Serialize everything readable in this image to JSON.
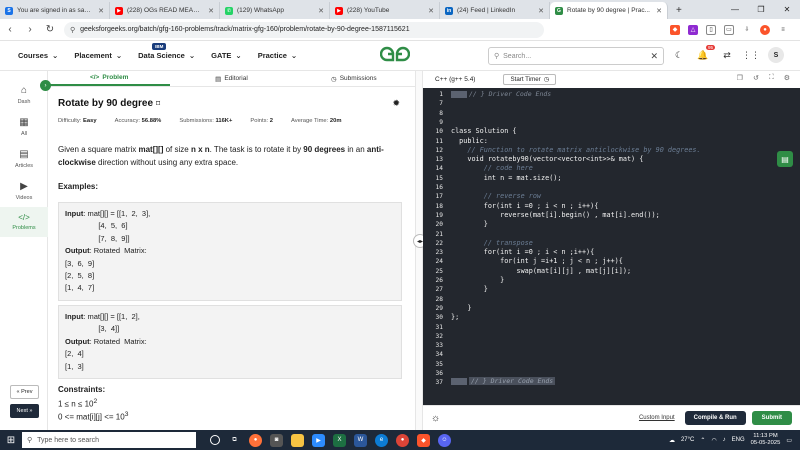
{
  "browser": {
    "tabs": [
      {
        "label": "You are signed in as sambhav...",
        "color": "#1a73e8",
        "glyph": "S"
      },
      {
        "label": "(228) OGs READ MEAN COMM...",
        "color": "#ff0000",
        "glyph": "▶"
      },
      {
        "label": "(129) WhatsApp",
        "color": "#25d366",
        "glyph": "✆"
      },
      {
        "label": "(228) YouTube",
        "color": "#ff0000",
        "glyph": "▶"
      },
      {
        "label": "(24) Feed | LinkedIn",
        "color": "#0a66c2",
        "glyph": "in"
      },
      {
        "label": "Rotate by 90 degree | Prac...",
        "color": "#2f8d46",
        "glyph": "G"
      }
    ],
    "url": "geeksforgeeks.org/batch/gfg-160-problems/track/matrix-gfg-160/problem/rotate-by-90-degree-1587115621"
  },
  "nav": {
    "courses": "Courses",
    "placement": "Placement",
    "data_science": "Data Science",
    "ibm_badge": "IBM",
    "gate": "GATE",
    "practice": "Practice",
    "search_placeholder": "Search...",
    "notif_count": "95",
    "avatar": "S"
  },
  "sidebar": {
    "items": [
      {
        "label": "Dash",
        "icon": "⌂"
      },
      {
        "label": "All",
        "icon": "▦"
      },
      {
        "label": "Articles",
        "icon": "▤"
      },
      {
        "label": "Videos",
        "icon": "▶"
      },
      {
        "label": "Problems",
        "icon": "</>"
      }
    ],
    "prev": "« Prev",
    "next": "Next »"
  },
  "problem": {
    "tabs": [
      "Problem",
      "Editorial",
      "Submissions"
    ],
    "title": "Rotate by 90 degree",
    "difficulty_label": "Difficulty:",
    "difficulty": "Easy",
    "accuracy_label": "Accuracy:",
    "accuracy": "56.88%",
    "submissions_label": "Submissions:",
    "submissions": "116K+",
    "points_label": "Points:",
    "points": "2",
    "avgtime_label": "Average Time:",
    "avgtime": "20m",
    "desc_1": "Given a square matrix ",
    "desc_mat": "mat[][]",
    "desc_2": " of size ",
    "desc_nxn": "n x n",
    "desc_3": ". The task is to rotate it by ",
    "desc_90": "90 degrees",
    "desc_4": " in an ",
    "desc_acw": "anti-clockwise",
    "desc_5": " direction without using any extra space.",
    "examples_heading": "Examples:",
    "ex1": {
      "input_label": "Input",
      "input_lines": [
        ": mat[][] = [[1,  2,  3],",
        "                [4,  5,  6]",
        "                [7,  8,  9]]"
      ],
      "output_label": "Output",
      "output_text": ": Rotated  Matrix:",
      "output_lines": [
        "[3,  6,  9]",
        "[2,  5,  8]",
        "[1,  4,  7]"
      ]
    },
    "ex2": {
      "input_label": "Input",
      "input_lines": [
        ": mat[][] = [[1,  2],",
        "                [3,  4]]"
      ],
      "output_label": "Output",
      "output_text": ": Rotated  Matrix:",
      "output_lines": [
        "[2,  4]",
        "[1,  3]"
      ]
    },
    "constraints_heading": "Constraints:",
    "constraint_1": "1 ≤ n ≤ 10",
    "constraint_1_sup": "2",
    "constraint_2": "0 <= mat[i][j] <= 10",
    "constraint_2_sup": "3"
  },
  "editor": {
    "language": "C++ (g++ 5.4)",
    "start_timer": "Start Timer",
    "fold_top": "// } Driver Code Ends",
    "fold_bottom": "// } Driver Code Ends",
    "line_numbers": [
      "1",
      "7",
      "8",
      "9",
      "10",
      "11",
      "12",
      "13",
      "14",
      "15",
      "16",
      "17",
      "18",
      "19",
      "20",
      "21",
      "22",
      "23",
      "24",
      "25",
      "26",
      "27",
      "28",
      "29",
      "30",
      "31",
      "32",
      "33",
      "34",
      "35",
      "36",
      "37"
    ],
    "lines": [
      "",
      "",
      "",
      "",
      "class Solution {",
      "  public:",
      "    // Function to rotate matrix anticlockwise by 90 degrees.",
      "    void rotateby90(vector<vector<int>>& mat) {",
      "        // code here",
      "        int n = mat.size();",
      "",
      "        // reverse row",
      "        for(int i =0 ; i < n ; i++){",
      "            reverse(mat[i].begin() , mat[i].end());",
      "        }",
      "",
      "        // transpose",
      "        for(int i =0 ; i < n ;i++){",
      "            for(int j =i+1 ; j < n ; j++){",
      "                swap(mat[i][j] , mat[j][i]);",
      "            }",
      "        }",
      "",
      "    }",
      "};",
      "",
      "",
      "",
      "",
      "",
      "",
      ""
    ],
    "custom_input": "Custom Input",
    "compile_run": "Compile & Run",
    "submit": "Submit"
  },
  "taskbar": {
    "search_placeholder": "Type here to search",
    "temp": "27°C",
    "lang": "ENG",
    "time": "11:13 PM",
    "date": "05-05-2025"
  }
}
